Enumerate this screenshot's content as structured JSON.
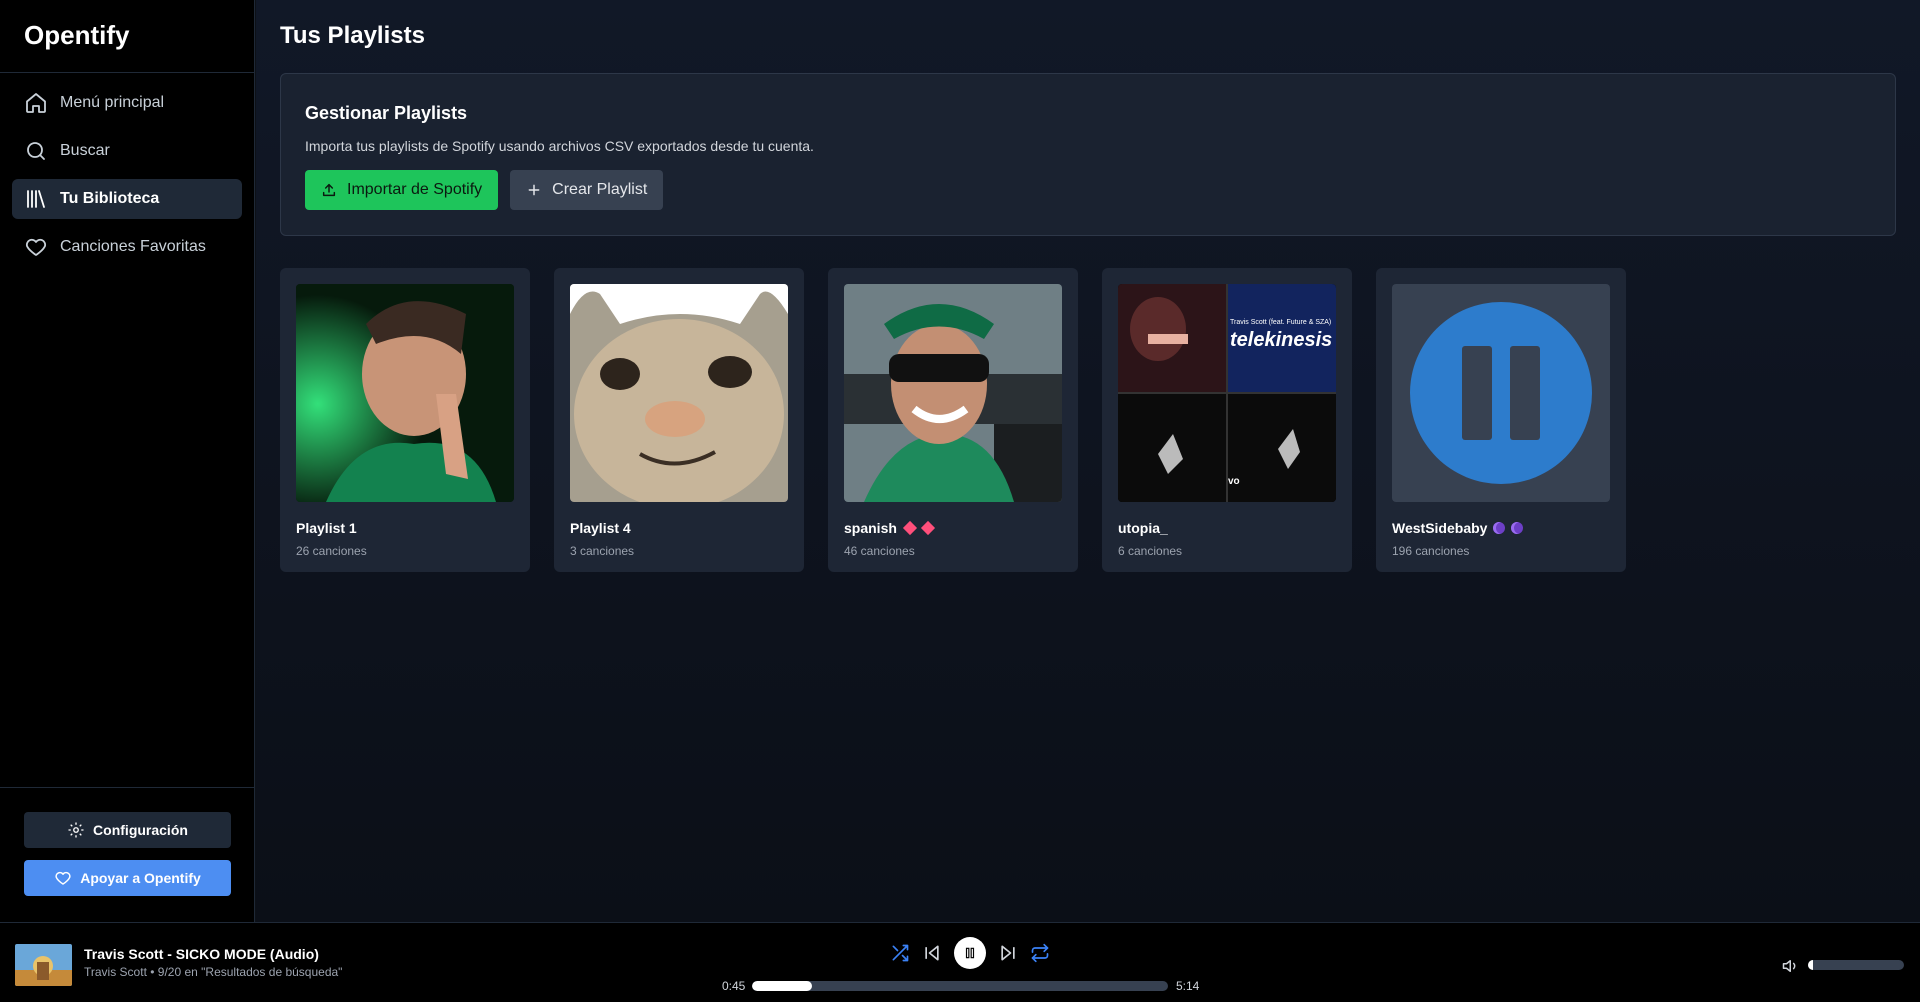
{
  "app": {
    "name": "Opentify"
  },
  "sidebar": {
    "items": [
      {
        "label": "Menú principal",
        "icon": "home-icon",
        "active": false
      },
      {
        "label": "Buscar",
        "icon": "search-icon",
        "active": false
      },
      {
        "label": "Tu Biblioteca",
        "icon": "library-icon",
        "active": true
      },
      {
        "label": "Canciones Favoritas",
        "icon": "heart-icon",
        "active": false
      }
    ],
    "config_label": "Configuración",
    "support_label": "Apoyar a Opentify"
  },
  "main": {
    "title": "Tus Playlists",
    "manage": {
      "title": "Gestionar Playlists",
      "description": "Importa tus playlists de Spotify usando archivos CSV exportados desde tu cuenta.",
      "import_label": "Importar de Spotify",
      "create_label": "Crear Playlist"
    },
    "playlists": [
      {
        "name": "Playlist 1",
        "count": "26 canciones"
      },
      {
        "name": "Playlist 4",
        "count": "3 canciones"
      },
      {
        "name": "spanish",
        "count": "46 canciones"
      },
      {
        "name": "utopia_",
        "count": "6 canciones"
      },
      {
        "name": "WestSidebaby",
        "count": "196 canciones"
      }
    ],
    "cover_texts": {
      "telekinesis": "telekinesis",
      "telekinesis_sub": "Travis Scott (feat. Future & SZA)",
      "vo": "vo"
    }
  },
  "player": {
    "title": "Travis Scott - SICKO MODE (Audio)",
    "subtitle": "Travis Scott • 9/20 en \"Resultados de búsqueda\"",
    "elapsed": "0:45",
    "duration": "5:14",
    "progress": 0.145,
    "volume": 0.05
  },
  "colors": {
    "accent_green": "#1ec55b",
    "accent_blue": "#4d8ef2",
    "shuffle_blue": "#3b82f6"
  }
}
